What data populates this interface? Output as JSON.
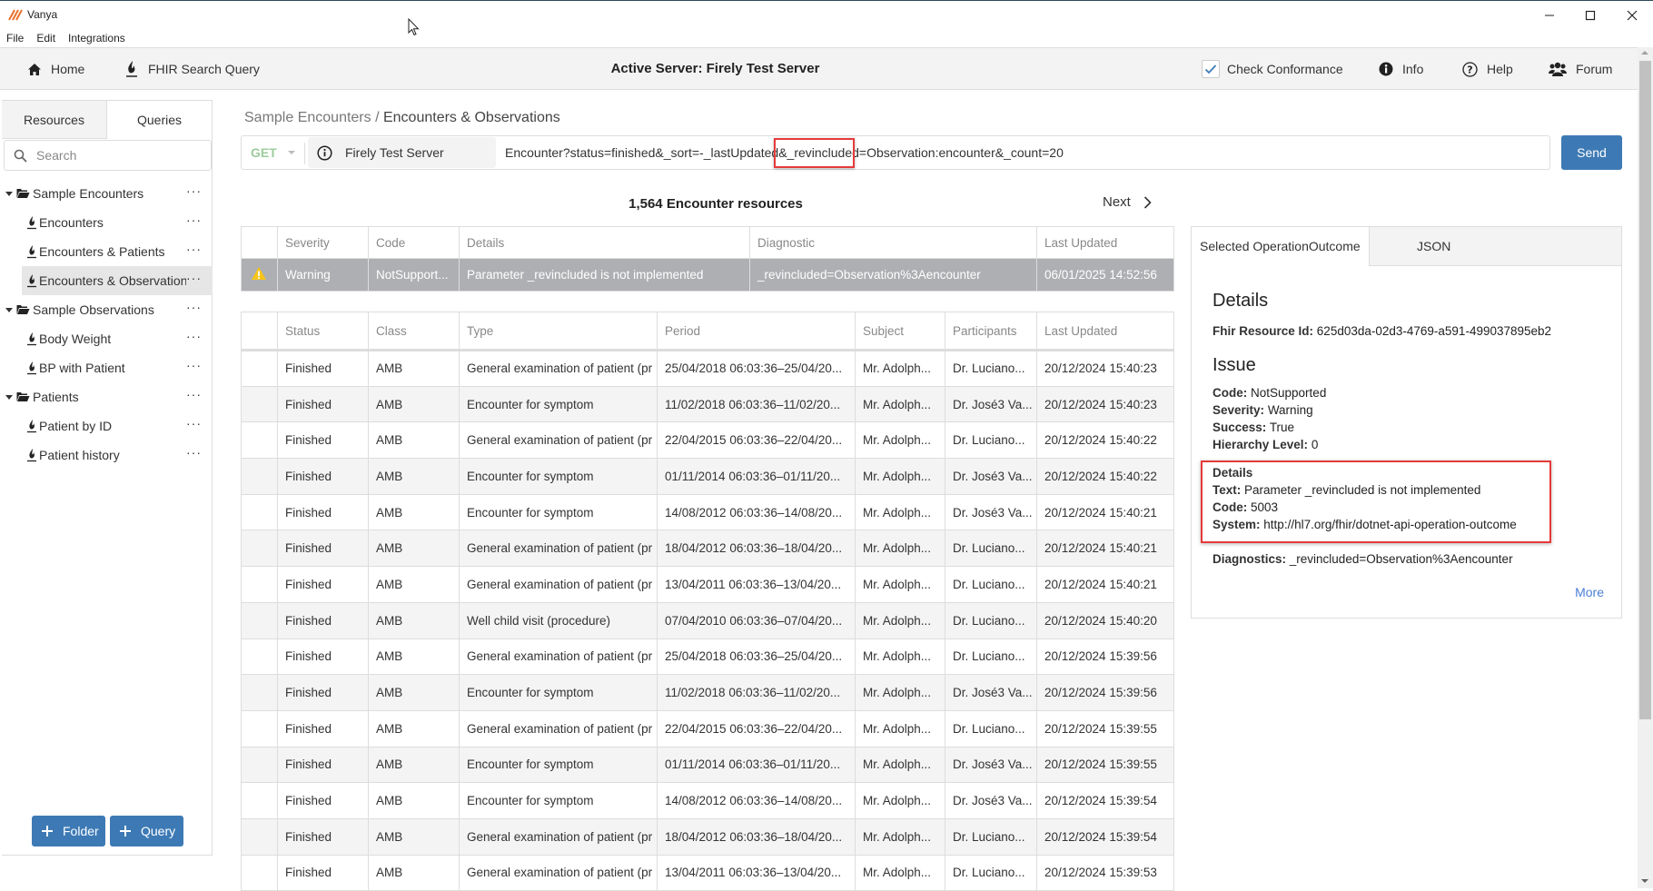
{
  "window": {
    "app_title": "Vanya",
    "menu": [
      "File",
      "Edit",
      "Integrations"
    ],
    "controls": {
      "minimize": "—",
      "maximize": "☐",
      "close": "✕"
    }
  },
  "toolbar": {
    "home_label": "Home",
    "fhir_search_label": "FHIR Search Query",
    "active_server": "Active Server: Firely Test Server",
    "check_conformance_label": "Check Conformance",
    "check_conformance_checked": true,
    "info_label": "Info",
    "help_label": "Help",
    "forum_label": "Forum"
  },
  "sidebar": {
    "tabs": [
      "Resources",
      "Queries"
    ],
    "active_tab": "Queries",
    "search_placeholder": "Search",
    "tree": [
      {
        "type": "folder",
        "label": "Sample Encounters",
        "expanded": true
      },
      {
        "type": "query",
        "label": "Encounters"
      },
      {
        "type": "query",
        "label": "Encounters & Patients"
      },
      {
        "type": "query",
        "label": "Encounters & Observations",
        "selected": true
      },
      {
        "type": "folder",
        "label": "Sample Observations",
        "expanded": true
      },
      {
        "type": "query",
        "label": "Body Weight"
      },
      {
        "type": "query",
        "label": "BP with Patient"
      },
      {
        "type": "folder",
        "label": "Patients",
        "expanded": true
      },
      {
        "type": "query",
        "label": "Patient by ID"
      },
      {
        "type": "query",
        "label": "Patient history"
      }
    ],
    "more_label": "···",
    "add_folder_label": "Folder",
    "add_query_label": "Query"
  },
  "breadcrumb": {
    "parent": "Sample Encounters",
    "separator": " / ",
    "current": "Encounters & Observations"
  },
  "query": {
    "method": "GET",
    "server": "Firely Test Server",
    "url": "Encounter?status=finished&_sort=-_lastUpdated&_revincluded=Observation:encounter&_count=20",
    "send_label": "Send"
  },
  "results": {
    "count_label": "1,564 Encounter resources",
    "next_label": "Next"
  },
  "outcome_table": {
    "headers": [
      "",
      "Severity",
      "Code",
      "Details",
      "Diagnostic",
      "Last Updated"
    ],
    "rows": [
      {
        "severity": "Warning",
        "code": "NotSupport...",
        "details": "Parameter _revincluded is not implemented",
        "diagnostic": "_revincluded=Observation%3Aencounter",
        "last_updated": "06/01/2025 14:52:56"
      }
    ]
  },
  "encounter_table": {
    "headers": [
      "",
      "Status",
      "Class",
      "Type",
      "Period",
      "Subject",
      "Participants",
      "Last Updated"
    ],
    "rows": [
      {
        "status": "Finished",
        "class": "AMB",
        "type": "General examination of patient (pr",
        "period": "25/04/2018 06:03:36–25/04/20...",
        "subject": "Mr. Adolph...",
        "participants": "Dr. Luciano...",
        "last_updated": "20/12/2024 15:40:23"
      },
      {
        "status": "Finished",
        "class": "AMB",
        "type": "Encounter for symptom",
        "period": "11/02/2018 06:03:36–11/02/20...",
        "subject": "Mr. Adolph...",
        "participants": "Dr. José3 Va...",
        "last_updated": "20/12/2024 15:40:23"
      },
      {
        "status": "Finished",
        "class": "AMB",
        "type": "General examination of patient (pr",
        "period": "22/04/2015 06:03:36–22/04/20...",
        "subject": "Mr. Adolph...",
        "participants": "Dr. Luciano...",
        "last_updated": "20/12/2024 15:40:22"
      },
      {
        "status": "Finished",
        "class": "AMB",
        "type": "Encounter for symptom",
        "period": "01/11/2014 06:03:36–01/11/20...",
        "subject": "Mr. Adolph...",
        "participants": "Dr. José3 Va...",
        "last_updated": "20/12/2024 15:40:22"
      },
      {
        "status": "Finished",
        "class": "AMB",
        "type": "Encounter for symptom",
        "period": "14/08/2012 06:03:36–14/08/20...",
        "subject": "Mr. Adolph...",
        "participants": "Dr. José3 Va...",
        "last_updated": "20/12/2024 15:40:21"
      },
      {
        "status": "Finished",
        "class": "AMB",
        "type": "General examination of patient (pr",
        "period": "18/04/2012 06:03:36–18/04/20...",
        "subject": "Mr. Adolph...",
        "participants": "Dr. Luciano...",
        "last_updated": "20/12/2024 15:40:21"
      },
      {
        "status": "Finished",
        "class": "AMB",
        "type": "General examination of patient (pr",
        "period": "13/04/2011 06:03:36–13/04/20...",
        "subject": "Mr. Adolph...",
        "participants": "Dr. Luciano...",
        "last_updated": "20/12/2024 15:40:21"
      },
      {
        "status": "Finished",
        "class": "AMB",
        "type": "Well child visit (procedure)",
        "period": "07/04/2010 06:03:36–07/04/20...",
        "subject": "Mr. Adolph...",
        "participants": "Dr. Luciano...",
        "last_updated": "20/12/2024 15:40:20"
      },
      {
        "status": "Finished",
        "class": "AMB",
        "type": "General examination of patient (pr",
        "period": "25/04/2018 06:03:36–25/04/20...",
        "subject": "Mr. Adolph...",
        "participants": "Dr. Luciano...",
        "last_updated": "20/12/2024 15:39:56"
      },
      {
        "status": "Finished",
        "class": "AMB",
        "type": "Encounter for symptom",
        "period": "11/02/2018 06:03:36–11/02/20...",
        "subject": "Mr. Adolph...",
        "participants": "Dr. José3 Va...",
        "last_updated": "20/12/2024 15:39:56"
      },
      {
        "status": "Finished",
        "class": "AMB",
        "type": "General examination of patient (pr",
        "period": "22/04/2015 06:03:36–22/04/20...",
        "subject": "Mr. Adolph...",
        "participants": "Dr. Luciano...",
        "last_updated": "20/12/2024 15:39:55"
      },
      {
        "status": "Finished",
        "class": "AMB",
        "type": "Encounter for symptom",
        "period": "01/11/2014 06:03:36–01/11/20...",
        "subject": "Mr. Adolph...",
        "participants": "Dr. José3 Va...",
        "last_updated": "20/12/2024 15:39:55"
      },
      {
        "status": "Finished",
        "class": "AMB",
        "type": "Encounter for symptom",
        "period": "14/08/2012 06:03:36–14/08/20...",
        "subject": "Mr. Adolph...",
        "participants": "Dr. José3 Va...",
        "last_updated": "20/12/2024 15:39:54"
      },
      {
        "status": "Finished",
        "class": "AMB",
        "type": "General examination of patient (pr",
        "period": "18/04/2012 06:03:36–18/04/20...",
        "subject": "Mr. Adolph...",
        "participants": "Dr. Luciano...",
        "last_updated": "20/12/2024 15:39:54"
      },
      {
        "status": "Finished",
        "class": "AMB",
        "type": "General examination of patient (pr",
        "period": "13/04/2011 06:03:36–13/04/20...",
        "subject": "Mr. Adolph...",
        "participants": "Dr. Luciano...",
        "last_updated": "20/12/2024 15:39:53"
      }
    ]
  },
  "detail_panel": {
    "tabs": [
      "Selected OperationOutcome",
      "JSON"
    ],
    "active_tab": "Selected OperationOutcome",
    "details_heading": "Details",
    "resource_id_label": "Fhir Resource Id:",
    "resource_id": "625d03da-02d3-4769-a591-499037895eb2",
    "issue_heading": "Issue",
    "code_label": "Code:",
    "code": "NotSupported",
    "severity_label": "Severity:",
    "severity": "Warning",
    "success_label": "Success:",
    "success": "True",
    "hierarchy_label": "Hierarchy Level:",
    "hierarchy": "0",
    "issue_details_heading": "Details",
    "text_label": "Text:",
    "text": "Parameter _revincluded is not implemented",
    "detail_code_label": "Code:",
    "detail_code": "5003",
    "system_label": "System:",
    "system": "http://hl7.org/fhir/dotnet-api-operation-outcome",
    "diagnostics_label": "Diagnostics:",
    "diagnostics": "_revincluded=Observation%3Aencounter",
    "more_label": "More"
  },
  "colors": {
    "accent_button": "#3d7ab5",
    "link": "#4a7fd6",
    "highlight_box": "#e63a3a",
    "warning_row": "#adafb2",
    "warning_icon": "#f5c518",
    "method_get": "#9ccc9c"
  }
}
